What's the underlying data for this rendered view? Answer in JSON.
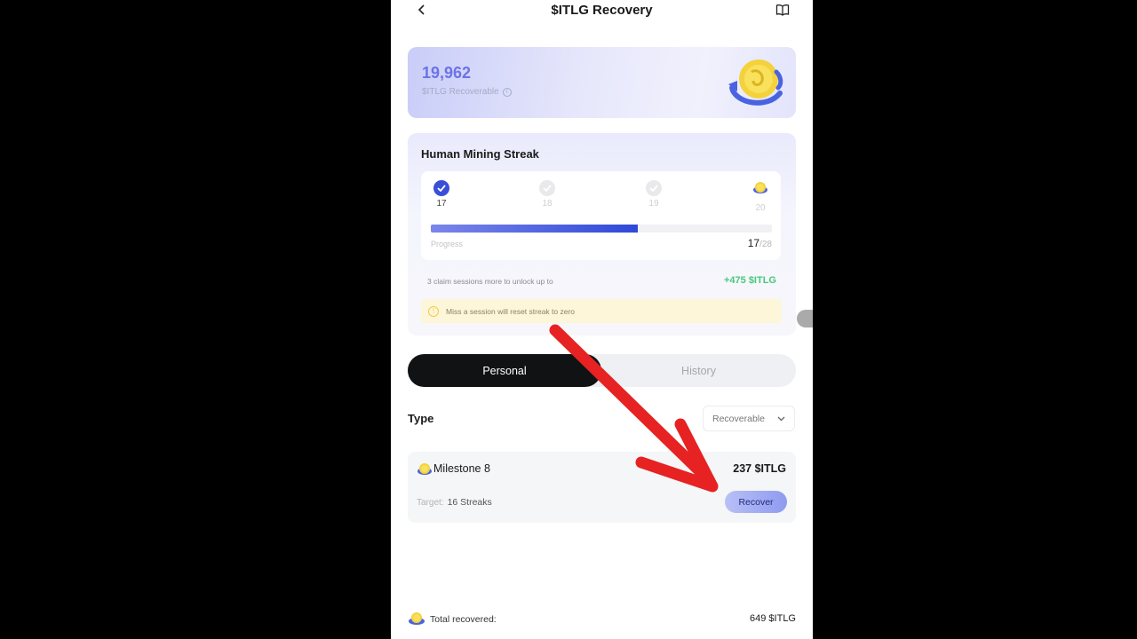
{
  "header": {
    "title": "$ITLG Recovery",
    "back_icon": "chevron-left-icon",
    "guide_icon": "book-icon"
  },
  "balance": {
    "value": "19,962",
    "label": "$ITLG Recoverable"
  },
  "streak": {
    "title": "Human Mining Streak",
    "days": [
      {
        "num": "17",
        "state": "done"
      },
      {
        "num": "18",
        "state": "todo"
      },
      {
        "num": "19",
        "state": "todo"
      },
      {
        "num": "20",
        "state": "reward"
      }
    ],
    "progress_label": "Progress",
    "progress_current": "17",
    "progress_total": "/28",
    "progress_fraction": 0.607,
    "claim_text": "3 claim sessions more to unlock up to",
    "claim_reward": "+475 $ITLG",
    "warning": "Miss a session will reset streak to zero"
  },
  "tabs": {
    "personal": "Personal",
    "history": "History"
  },
  "filter": {
    "label": "Type",
    "selected": "Recoverable"
  },
  "milestone": {
    "name": "Milestone 8",
    "amount": "237 $ITLG",
    "target_label": "Target:",
    "target_value": "16 Streaks",
    "button": "Recover"
  },
  "footer": {
    "label": "Total recovered:",
    "value": "649 $ITLG"
  },
  "colors": {
    "accent": "#3a4fd8",
    "reward_green": "#47c97a",
    "annotation_arrow": "#e62222"
  }
}
